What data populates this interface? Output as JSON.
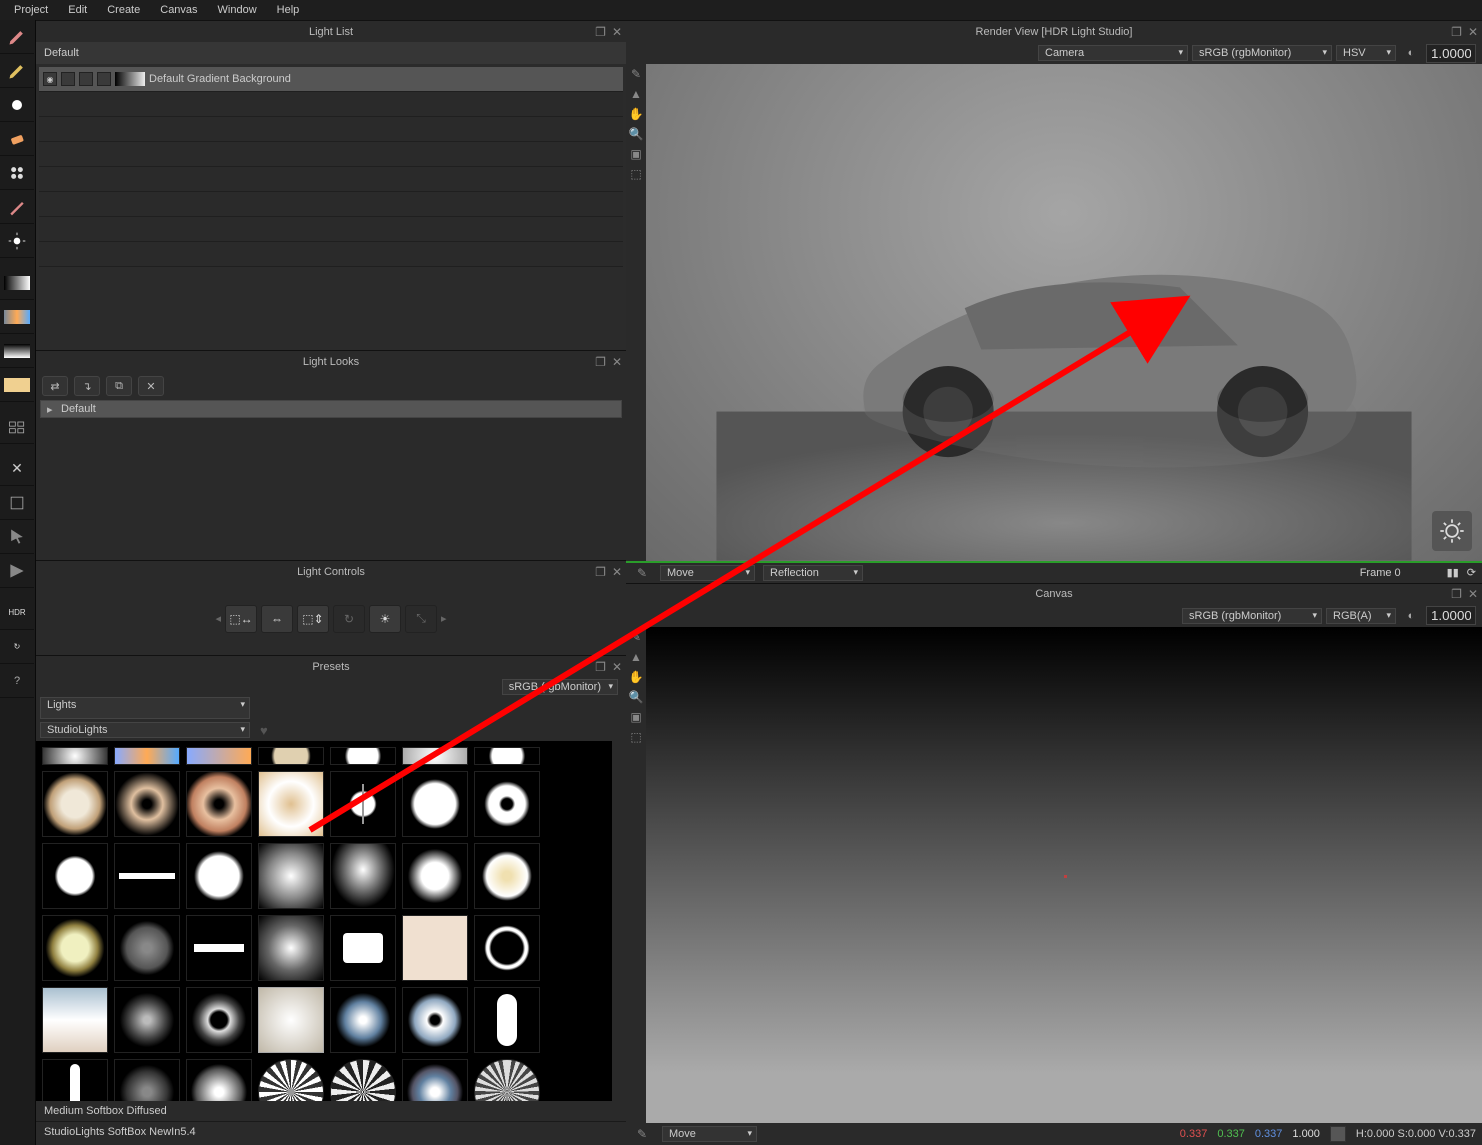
{
  "menu": {
    "items": [
      "Project",
      "Edit",
      "Create",
      "Canvas",
      "Window",
      "Help"
    ]
  },
  "panels": {
    "light_list": {
      "title": "Light List",
      "sub": "Default",
      "row_label": "Default Gradient Background"
    },
    "light_looks": {
      "title": "Light Looks",
      "item": "Default"
    },
    "light_controls": {
      "title": "Light Controls"
    },
    "presets": {
      "title": "Presets",
      "color_profile": "sRGB (rgbMonitor)",
      "category": "Lights",
      "subcategory": "StudioLights",
      "selected_name": "Medium Softbox Diffused",
      "selected_tags": "StudioLights SoftBox NewIn5.4"
    },
    "render_view": {
      "title": "Render View [HDR Light Studio]",
      "camera": "Camera",
      "color_profile": "sRGB (rgbMonitor)",
      "mode": "HSV",
      "value": "1.0000",
      "move": "Move",
      "reflection": "Reflection",
      "frame": "Frame 0"
    },
    "canvas": {
      "title": "Canvas",
      "color_profile": "sRGB (rgbMonitor)",
      "channels": "RGB(A)",
      "value": "1.0000",
      "move": "Move",
      "rgb_r": "0.337",
      "rgb_g": "0.337",
      "rgb_b": "0.337",
      "rgb_a": "1.000",
      "hsv": "H:0.000 S:0.000 V:0.337"
    }
  }
}
